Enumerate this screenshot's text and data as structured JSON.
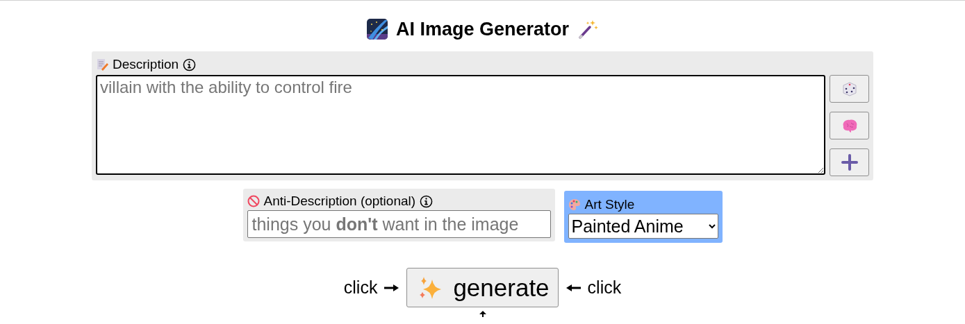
{
  "title": "AI Image Generator",
  "description": {
    "label": "Description",
    "placeholder": "villain with the ability to control fire"
  },
  "anti_description": {
    "label": "Anti-Description (optional)",
    "placeholder": "things you **don't** want in the image"
  },
  "art_style": {
    "label": "Art Style",
    "value": "Painted Anime"
  },
  "generate": {
    "label": "generate",
    "left_hint": "click",
    "right_hint": "click"
  }
}
